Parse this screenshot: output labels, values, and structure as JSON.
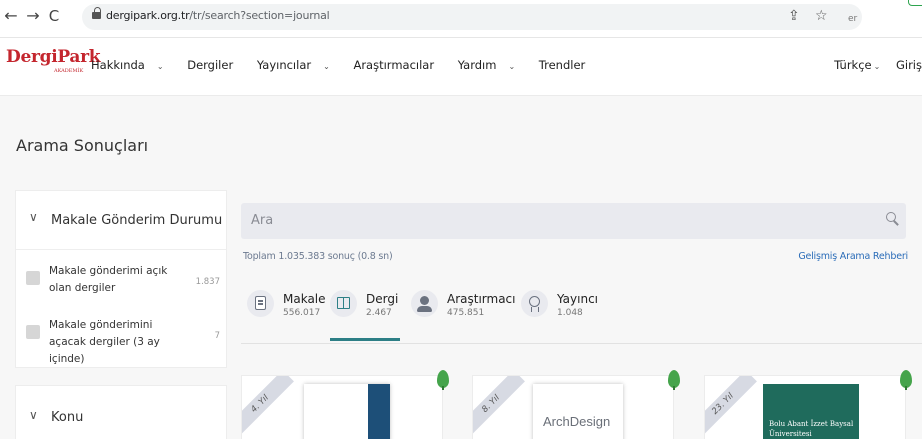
{
  "browser": {
    "url_host": "dergipark.org.tr",
    "url_path": "/tr/search?section=journal",
    "ext_fragment": "er"
  },
  "site": {
    "logo": "DergiPark",
    "logo_sub": "AKADEMİK",
    "menu": [
      {
        "label": "Hakkında",
        "dropdown": true
      },
      {
        "label": "Dergiler",
        "dropdown": false
      },
      {
        "label": "Yayıncılar",
        "dropdown": true
      },
      {
        "label": "Araştırmacılar",
        "dropdown": false
      },
      {
        "label": "Yardım",
        "dropdown": true
      },
      {
        "label": "Trendler",
        "dropdown": false
      }
    ],
    "language": "Türkçe",
    "login": "Giriş"
  },
  "page": {
    "title": "Arama Sonuçları"
  },
  "filters": {
    "submission": {
      "title": "Makale Gönderim Durumu",
      "options": [
        {
          "label": "Makale gönderimi açık olan dergiler",
          "count": "1.837"
        },
        {
          "label": "Makale gönderimini açacak dergiler (3 ay içinde)",
          "count": "7"
        }
      ]
    },
    "subject": {
      "title": "Konu"
    }
  },
  "search": {
    "placeholder": "Ara",
    "summary": "Toplam 1.035.383 sonuç (0.8 sn)",
    "advanced_link": "Gelişmiş Arama Rehberi"
  },
  "tabs": [
    {
      "label": "Makale",
      "count": "556.017",
      "icon": "document-icon",
      "active": false
    },
    {
      "label": "Dergi",
      "count": "2.467",
      "icon": "book-icon",
      "active": true
    },
    {
      "label": "Araştırmacı",
      "count": "475.851",
      "icon": "person-icon",
      "active": false
    },
    {
      "label": "Yayıncı",
      "count": "1.048",
      "icon": "badge-icon",
      "active": false
    }
  ],
  "journals": [
    {
      "age": "4. Yıl",
      "cover_text": "",
      "cover_subtitle": ""
    },
    {
      "age": "8. Yıl",
      "cover_text": "ArchDesign",
      "cover_subtitle": ""
    },
    {
      "age": "23. Yıl",
      "cover_text": "Bolu Abant İzzet Baysal",
      "cover_subtitle": "Üniversitesi"
    }
  ],
  "colors": {
    "brand": "#c4262e",
    "accent": "#2d7f86",
    "link": "#2a6cb8",
    "tree": "#45a44b"
  }
}
